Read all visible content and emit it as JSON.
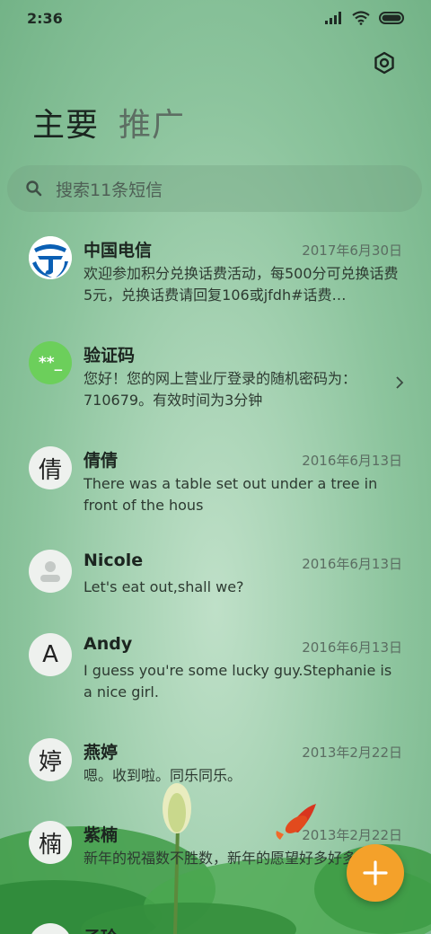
{
  "status": {
    "time": "2:36"
  },
  "tabs": [
    {
      "label": "主要"
    },
    {
      "label": "推广"
    }
  ],
  "search": {
    "placeholder": "搜索11条短信"
  },
  "conversations": [
    {
      "name": "中国电信",
      "date": "2017年6月30日",
      "preview": "欢迎参加积分兑换话费活动，每500分可兑换话费5元，兑换话费请回复106或jfdh#话费…",
      "avatar": "china-telecom-logo"
    },
    {
      "name": "验证码",
      "date": "",
      "preview": "您好！您的网上营业厅登录的随机密码为：710679。有效时间为3分钟",
      "avatar_text": "**_"
    },
    {
      "name": "倩倩",
      "date": "2016年6月13日",
      "preview": "There was a table set out under a tree in front of the hous",
      "avatar_text": "倩"
    },
    {
      "name": "Nicole",
      "date": "2016年6月13日",
      "preview": "Let's eat out,shall we?",
      "avatar": "person-icon"
    },
    {
      "name": "Andy",
      "date": "2016年6月13日",
      "preview": "I guess you're some lucky guy.Stephanie is a nice girl.",
      "avatar_text": "A"
    },
    {
      "name": "燕婷",
      "date": "2013年2月22日",
      "preview": "嗯。收到啦。同乐同乐。",
      "avatar_text": "婷"
    },
    {
      "name": "紫楠",
      "date": "2013年2月22日",
      "preview": "新年的祝福数不胜数，新年的愿望好多好多，新年的问候依旧美好，在这个温馨的时刻…",
      "avatar_text": "楠"
    },
    {
      "name": "子玲",
      "date": "",
      "preview": "",
      "avatar_text": ""
    }
  ],
  "colors": {
    "accent": "#f4a12a",
    "verify_avatar": "#6ccf5b",
    "telecom_blue": "#0a5fb4"
  }
}
